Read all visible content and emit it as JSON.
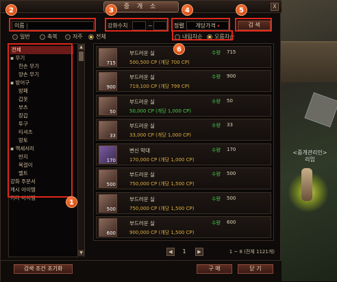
{
  "window": {
    "title": "중 개 소",
    "close": "X"
  },
  "search": {
    "name_label": "이름",
    "name_value": "",
    "enhance_label": "강화수치",
    "enhance_sep": "~",
    "sort_label": "정렬",
    "sort_value": "개당가격",
    "search_button": "검  색",
    "type_options": [
      {
        "label": "일반",
        "selected": false
      },
      {
        "label": "축복",
        "selected": false
      },
      {
        "label": "저주",
        "selected": false
      },
      {
        "label": "전체",
        "selected": true
      }
    ],
    "order_options": [
      {
        "label": "내림차순",
        "selected": false
      },
      {
        "label": "오름차순",
        "selected": true
      }
    ]
  },
  "categories": [
    {
      "label": "전체",
      "selected": true
    },
    {
      "label": "무기"
    },
    {
      "label": "한손 무기"
    },
    {
      "label": "양손 무기"
    },
    {
      "label": "방어구"
    },
    {
      "label": "방패"
    },
    {
      "label": "갑옷"
    },
    {
      "label": "부츠"
    },
    {
      "label": "장갑"
    },
    {
      "label": "투구"
    },
    {
      "label": "티셔츠"
    },
    {
      "label": "망토"
    },
    {
      "label": "액세서리"
    },
    {
      "label": "반지"
    },
    {
      "label": "목걸이"
    },
    {
      "label": "벨트"
    },
    {
      "label": "강화 주문서"
    },
    {
      "label": "캐시 아이템"
    },
    {
      "label": "기타 아이템"
    }
  ],
  "qty_label": "수량",
  "items": [
    {
      "name": "부드러운 실",
      "price": "500,500 CP (개당 700 CP)",
      "qty": "715",
      "icon_count": "715",
      "icon": "thread-icon"
    },
    {
      "name": "부드러운 실",
      "price": "719,100 CP (개당 799 CP)",
      "qty": "900",
      "icon_count": "900",
      "icon": "thread-icon"
    },
    {
      "name": "부드러운 실",
      "price": "50,000 CP (개당 1,000 CP)",
      "qty": "50",
      "icon_count": "50",
      "icon": "thread-icon",
      "price_color": "#4ad14a"
    },
    {
      "name": "부드러운 실",
      "price": "33,000 CP (개당 1,000 CP)",
      "qty": "33",
      "icon_count": "33",
      "icon": "thread-icon"
    },
    {
      "name": "변신 막대",
      "price": "170,000 CP (개당 1,000 CP)",
      "qty": "170",
      "icon_count": "170",
      "icon": "wand-icon"
    },
    {
      "name": "부드러운 실",
      "price": "750,000 CP (개당 1,500 CP)",
      "qty": "500",
      "icon_count": "500",
      "icon": "thread-icon"
    },
    {
      "name": "부드러운 실",
      "price": "750,000 CP (개당 1,500 CP)",
      "qty": "500",
      "icon_count": "500",
      "icon": "thread-icon"
    },
    {
      "name": "부드러운 실",
      "price": "900,000 CP (개당 1,500 CP)",
      "qty": "600",
      "icon_count": "600",
      "icon": "thread-icon"
    }
  ],
  "pagination": {
    "page": "1",
    "summary": "1 ~ 8 (전체 1121개)"
  },
  "bottom": {
    "reset_button": "검색 조건 초기화",
    "buy_button": "구  매",
    "close_button": "닫  기"
  },
  "scene": {
    "npc_label_1": "<중개관리인>",
    "npc_label_2": "리임"
  },
  "annotations": [
    "1",
    "2",
    "3",
    "4",
    "5",
    "6"
  ]
}
